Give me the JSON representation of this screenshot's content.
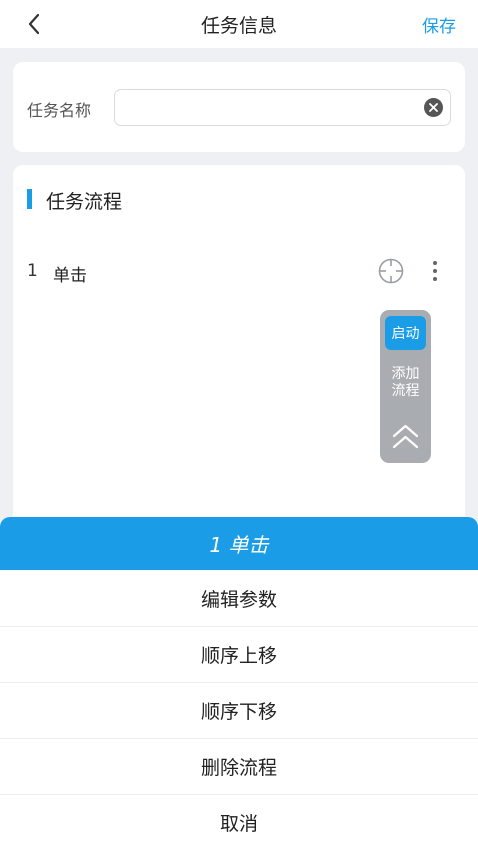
{
  "header": {
    "title": "任务信息",
    "save_label": "保存",
    "back_icon": "chevron-left-icon"
  },
  "task_name": {
    "label": "任务名称",
    "value": "",
    "clear_icon": "clear-icon"
  },
  "flow": {
    "section_title": "任务流程",
    "accent_color": "#1a9de6",
    "items": [
      {
        "index": "1",
        "name": "单击",
        "target_icon": "crosshair-icon",
        "menu_icon": "more-vertical-icon"
      }
    ]
  },
  "float_panel": {
    "start_label": "启动",
    "add_flow_line1": "添加",
    "add_flow_line2": "流程",
    "collapse_icon": "double-chevron-up-icon"
  },
  "action_sheet": {
    "title": "1 单击",
    "options": [
      "编辑参数",
      "顺序上移",
      "顺序下移",
      "删除流程",
      "取消"
    ]
  }
}
